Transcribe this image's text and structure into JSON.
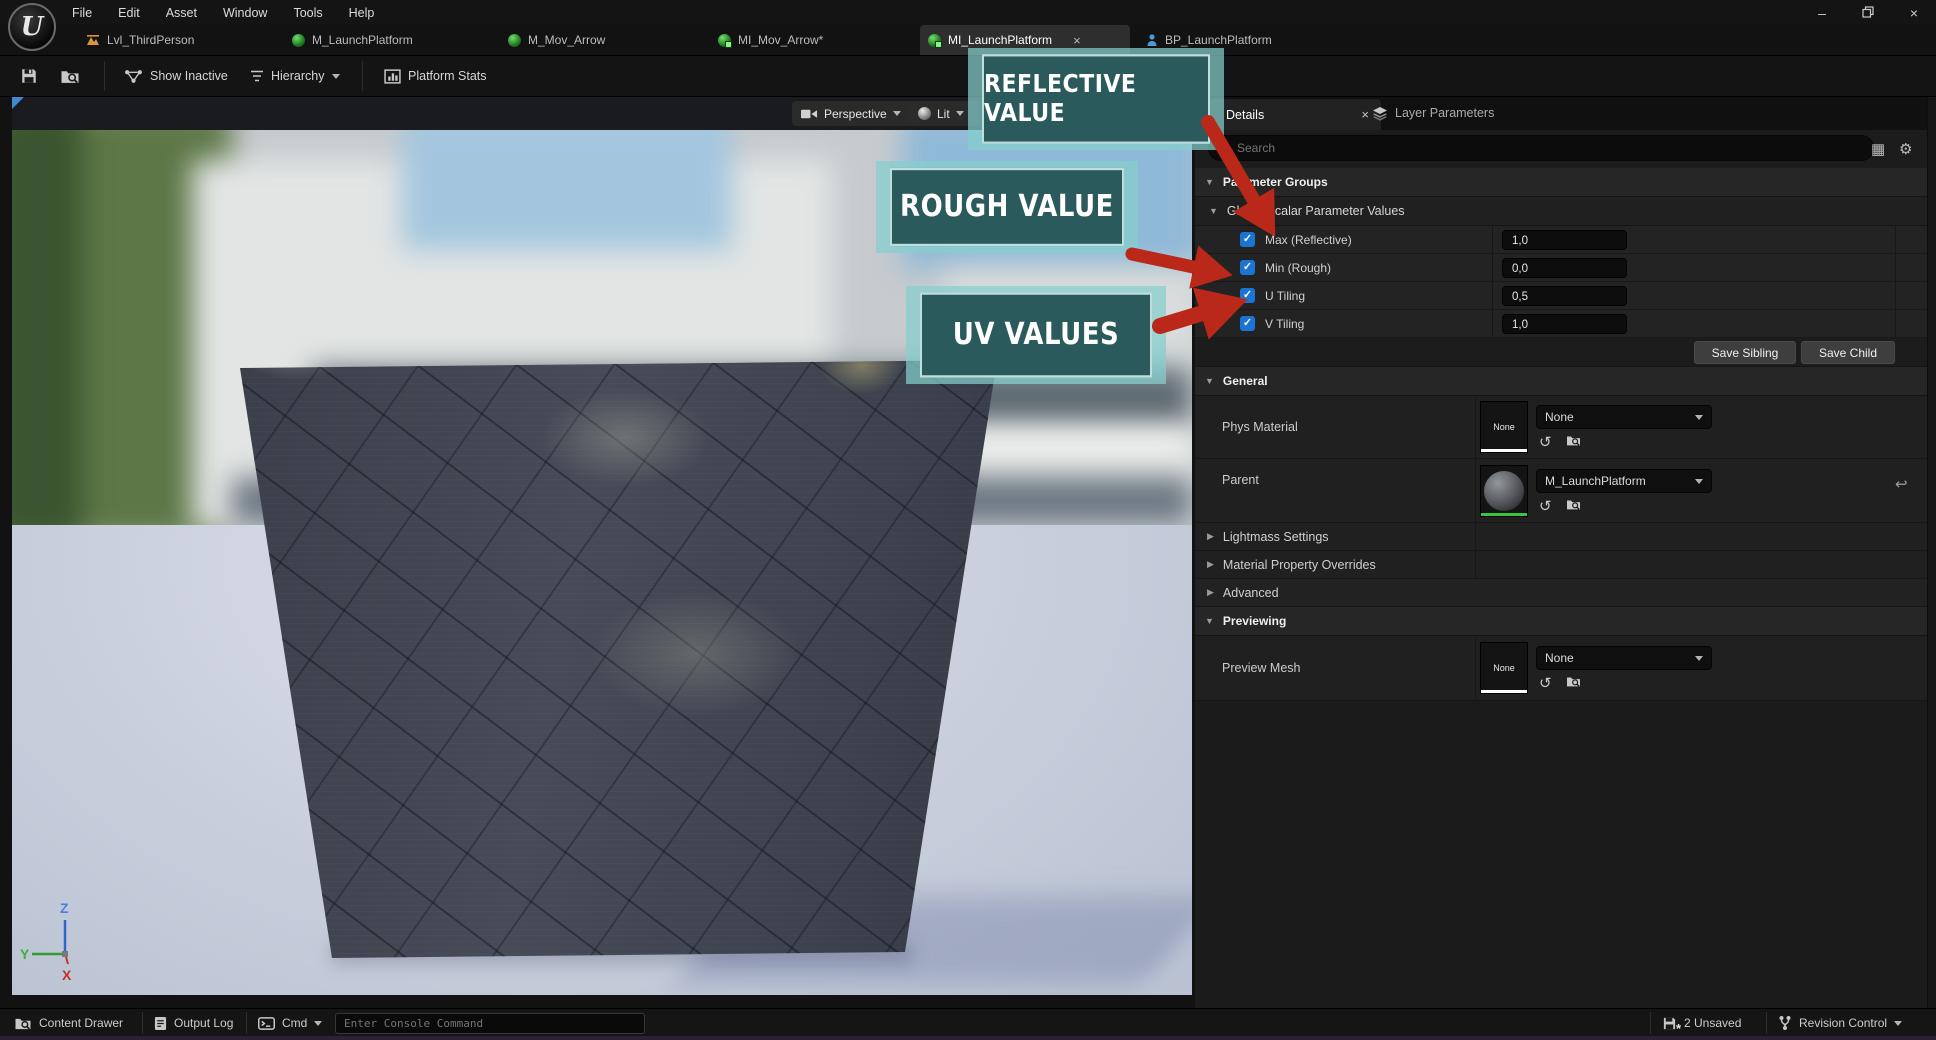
{
  "menu": {
    "items": [
      {
        "label": "File"
      },
      {
        "label": "Edit"
      },
      {
        "label": "Asset"
      },
      {
        "label": "Window"
      },
      {
        "label": "Tools"
      },
      {
        "label": "Help"
      }
    ]
  },
  "tabs": [
    {
      "label": "Lvl_ThirdPerson"
    },
    {
      "label": "M_LaunchPlatform"
    },
    {
      "label": "M_Mov_Arrow"
    },
    {
      "label": "MI_Mov_Arrow*"
    },
    {
      "label": "MI_LaunchPlatform"
    },
    {
      "label": "BP_LaunchPlatform"
    }
  ],
  "toolbar": {
    "show_inactive": "Show Inactive",
    "hierarchy": "Hierarchy",
    "platform_stats": "Platform Stats"
  },
  "viewport": {
    "perspective": "Perspective",
    "lit": "Lit",
    "axis": {
      "x": "X",
      "y": "Y",
      "z": "Z"
    }
  },
  "callouts": {
    "reflective": "REFLECTIVE VALUE",
    "rough": "ROUGH VALUE",
    "uv": "UV VALUES"
  },
  "details": {
    "tab_details": "Details",
    "tab_layer_parameters": "Layer Parameters",
    "search_placeholder": "Search",
    "parameter_groups": "Parameter Groups",
    "scalar_group": "Global Scalar Parameter Values",
    "params": [
      {
        "label": "Max (Reflective)",
        "value": "1,0",
        "checked": true
      },
      {
        "label": "Min (Rough)",
        "value": "0,0",
        "checked": true
      },
      {
        "label": "U Tiling",
        "value": "0,5",
        "checked": true
      },
      {
        "label": "V Tiling",
        "value": "1,0",
        "checked": true
      }
    ],
    "save_sibling": "Save Sibling",
    "save_child": "Save Child",
    "general": "General",
    "phys_material_label": "Phys Material",
    "phys_material_thumb": "None",
    "phys_material_value": "None",
    "parent_label": "Parent",
    "parent_value": "M_LaunchPlatform",
    "lightmass": "Lightmass Settings",
    "overrides": "Material Property Overrides",
    "advanced": "Advanced",
    "previewing": "Previewing",
    "preview_mesh_label": "Preview Mesh",
    "preview_mesh_thumb": "None",
    "preview_mesh_value": "None"
  },
  "status_bar": {
    "content_drawer": "Content Drawer",
    "output_log": "Output Log",
    "cmd": "Cmd",
    "console_placeholder": "Enter Console Command",
    "unsaved": "2 Unsaved",
    "revision_control": "Revision Control"
  },
  "icons": {
    "check": "✓",
    "close": "×",
    "gear": "⚙",
    "grid": "▦",
    "use_selected": "↺",
    "reset": "↩",
    "triangle_down": "▼",
    "triangle_right": "▶",
    "minimize": "–",
    "logo_letter": "U",
    "unsaved_star": "*"
  },
  "colors": {
    "checkbox_blue": "#1c74d2",
    "callout_fill": "#2b5a5c",
    "callout_glow": "#85cfcd",
    "arrow_red": "#b92819",
    "parent_thumb_underline": "#38c73c",
    "phys_thumb_underline": "#ffffff",
    "axis_x": "#c03424",
    "axis_y": "#3fae3f",
    "axis_z": "#4b7fe0"
  }
}
